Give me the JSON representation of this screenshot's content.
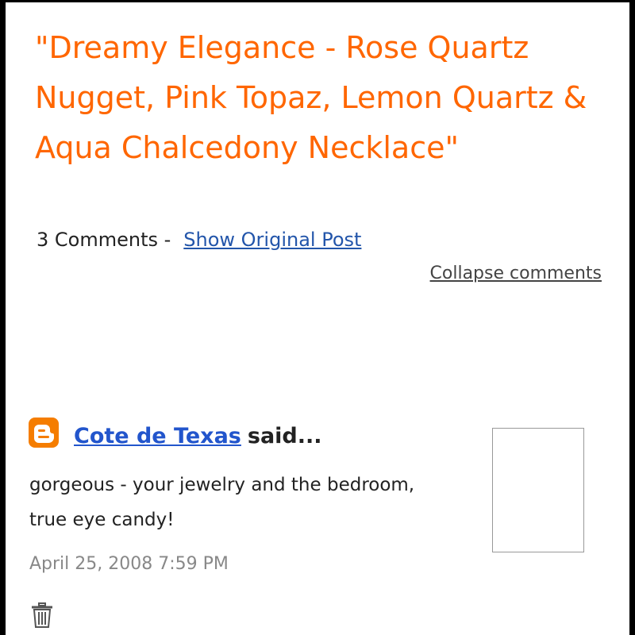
{
  "post": {
    "title": "\"Dreamy Elegance - Rose Quartz Nugget, Pink Topaz, Lemon Quartz & Aqua Chalcedony Necklace\"",
    "comment_count": "3 Comments -",
    "show_original_post": "Show Original Post",
    "collapse_comments": "Collapse comments"
  },
  "comments": [
    {
      "author": "Cote de Texas",
      "said": "said...",
      "body": "gorgeous - your jewelry and the bedroom, true eye candy!",
      "timestamp": "April 25, 2008 7:59 PM",
      "icon": "blogger-icon",
      "delete_icon": "trash-icon"
    }
  ],
  "colors": {
    "title": "#ff6600",
    "link": "#2255cc",
    "blogger_icon": "#f57d00",
    "timestamp": "#888888"
  }
}
